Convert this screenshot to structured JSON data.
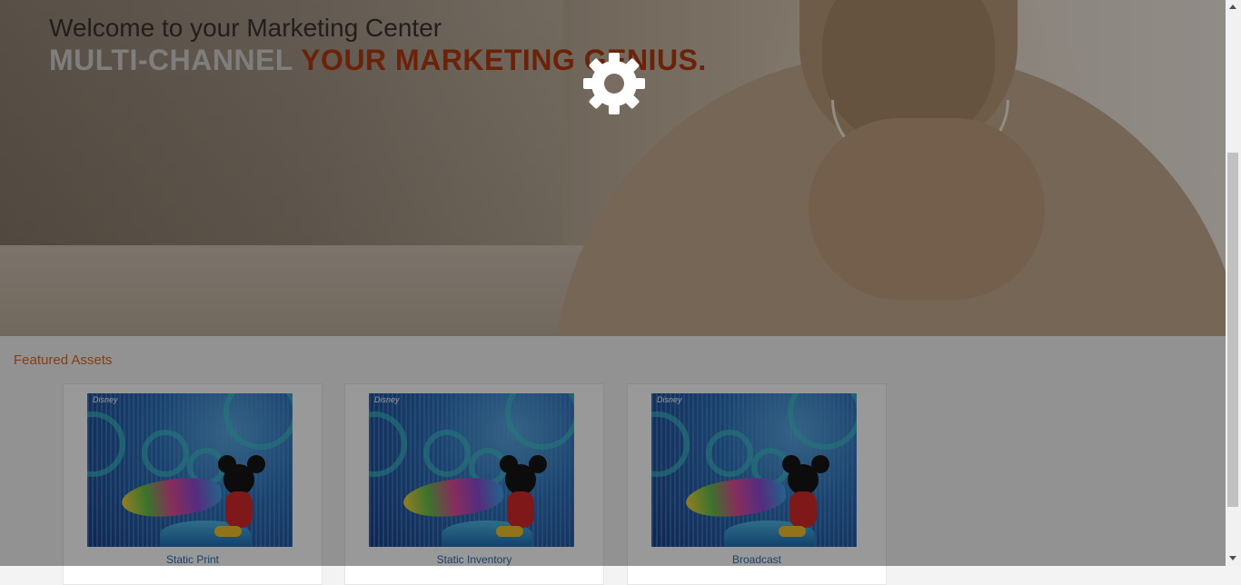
{
  "hero": {
    "welcome": "Welcome to your Marketing Center",
    "tagline_part1": "MULTI-CHANNEL ",
    "tagline_part2": "YOUR MARKETING GENIUS."
  },
  "featured": {
    "title": "Featured Assets",
    "cards": [
      {
        "label": "Static Print",
        "thumb_logo": "Disney"
      },
      {
        "label": "Static Inventory",
        "thumb_logo": "Disney"
      },
      {
        "label": "Broadcast",
        "thumb_logo": "Disney"
      }
    ]
  },
  "loading": {
    "icon": "gear-icon"
  },
  "colors": {
    "accent_orange": "#d46a28",
    "tagline_red": "#b33a10",
    "link_blue": "#2a6fb0"
  }
}
